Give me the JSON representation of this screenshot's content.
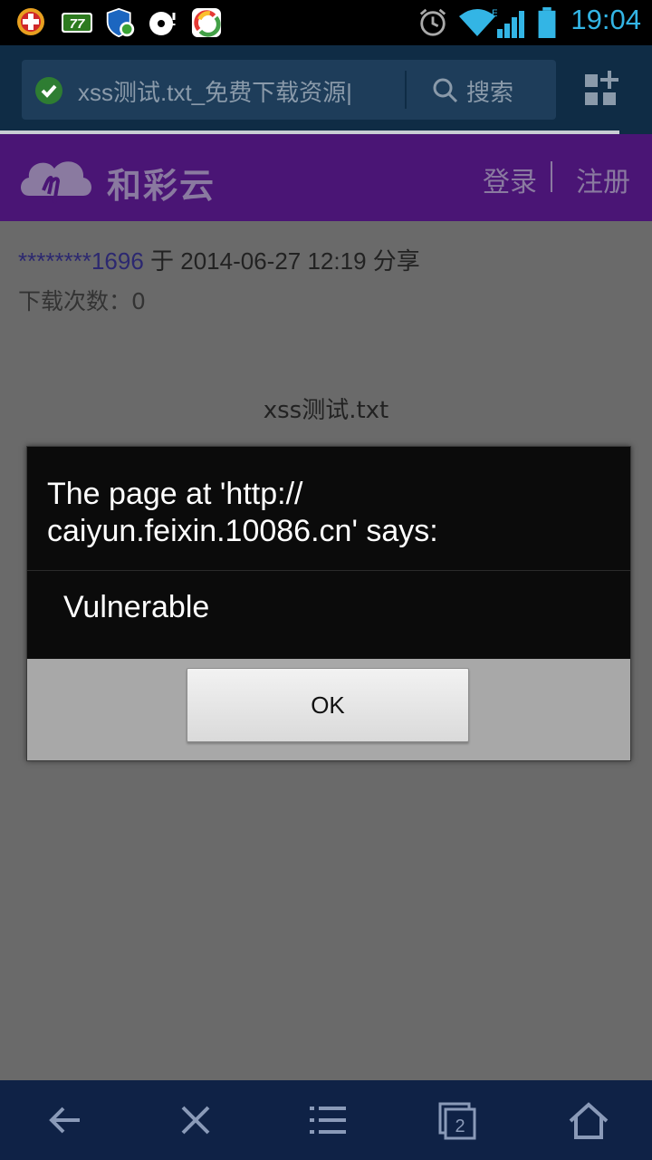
{
  "status_bar": {
    "time": "19:04",
    "notification_icons": [
      "add-app-icon",
      "battery-77-icon",
      "shield-security-icon",
      "media-icon",
      "camera-app-icon"
    ],
    "system_icons": [
      "alarm-icon",
      "wifi-icon",
      "signal-icon",
      "battery-icon"
    ],
    "badge_77": "77"
  },
  "browser": {
    "url_text": "xss测试.txt_免费下载资源|",
    "search_label": "搜索",
    "tabs_count": "2"
  },
  "site": {
    "brand": "和彩云",
    "login": "登录",
    "register": "注册"
  },
  "content": {
    "user": "********1696",
    "share_text": " 于 2014-06-27 12:19 分享",
    "download_count": "下载次数：0",
    "filename": "xss测试.txt"
  },
  "dialog": {
    "title": "The page at 'http:// caiyun.feixin.10086.cn' says:",
    "message": "Vulnerable",
    "ok": "OK"
  },
  "colors": {
    "status_time": "#33b5e5",
    "toolbar_bg": "#0f2c45",
    "site_header_bg": "#4a1575",
    "bottom_nav_bg": "#0f2246"
  }
}
